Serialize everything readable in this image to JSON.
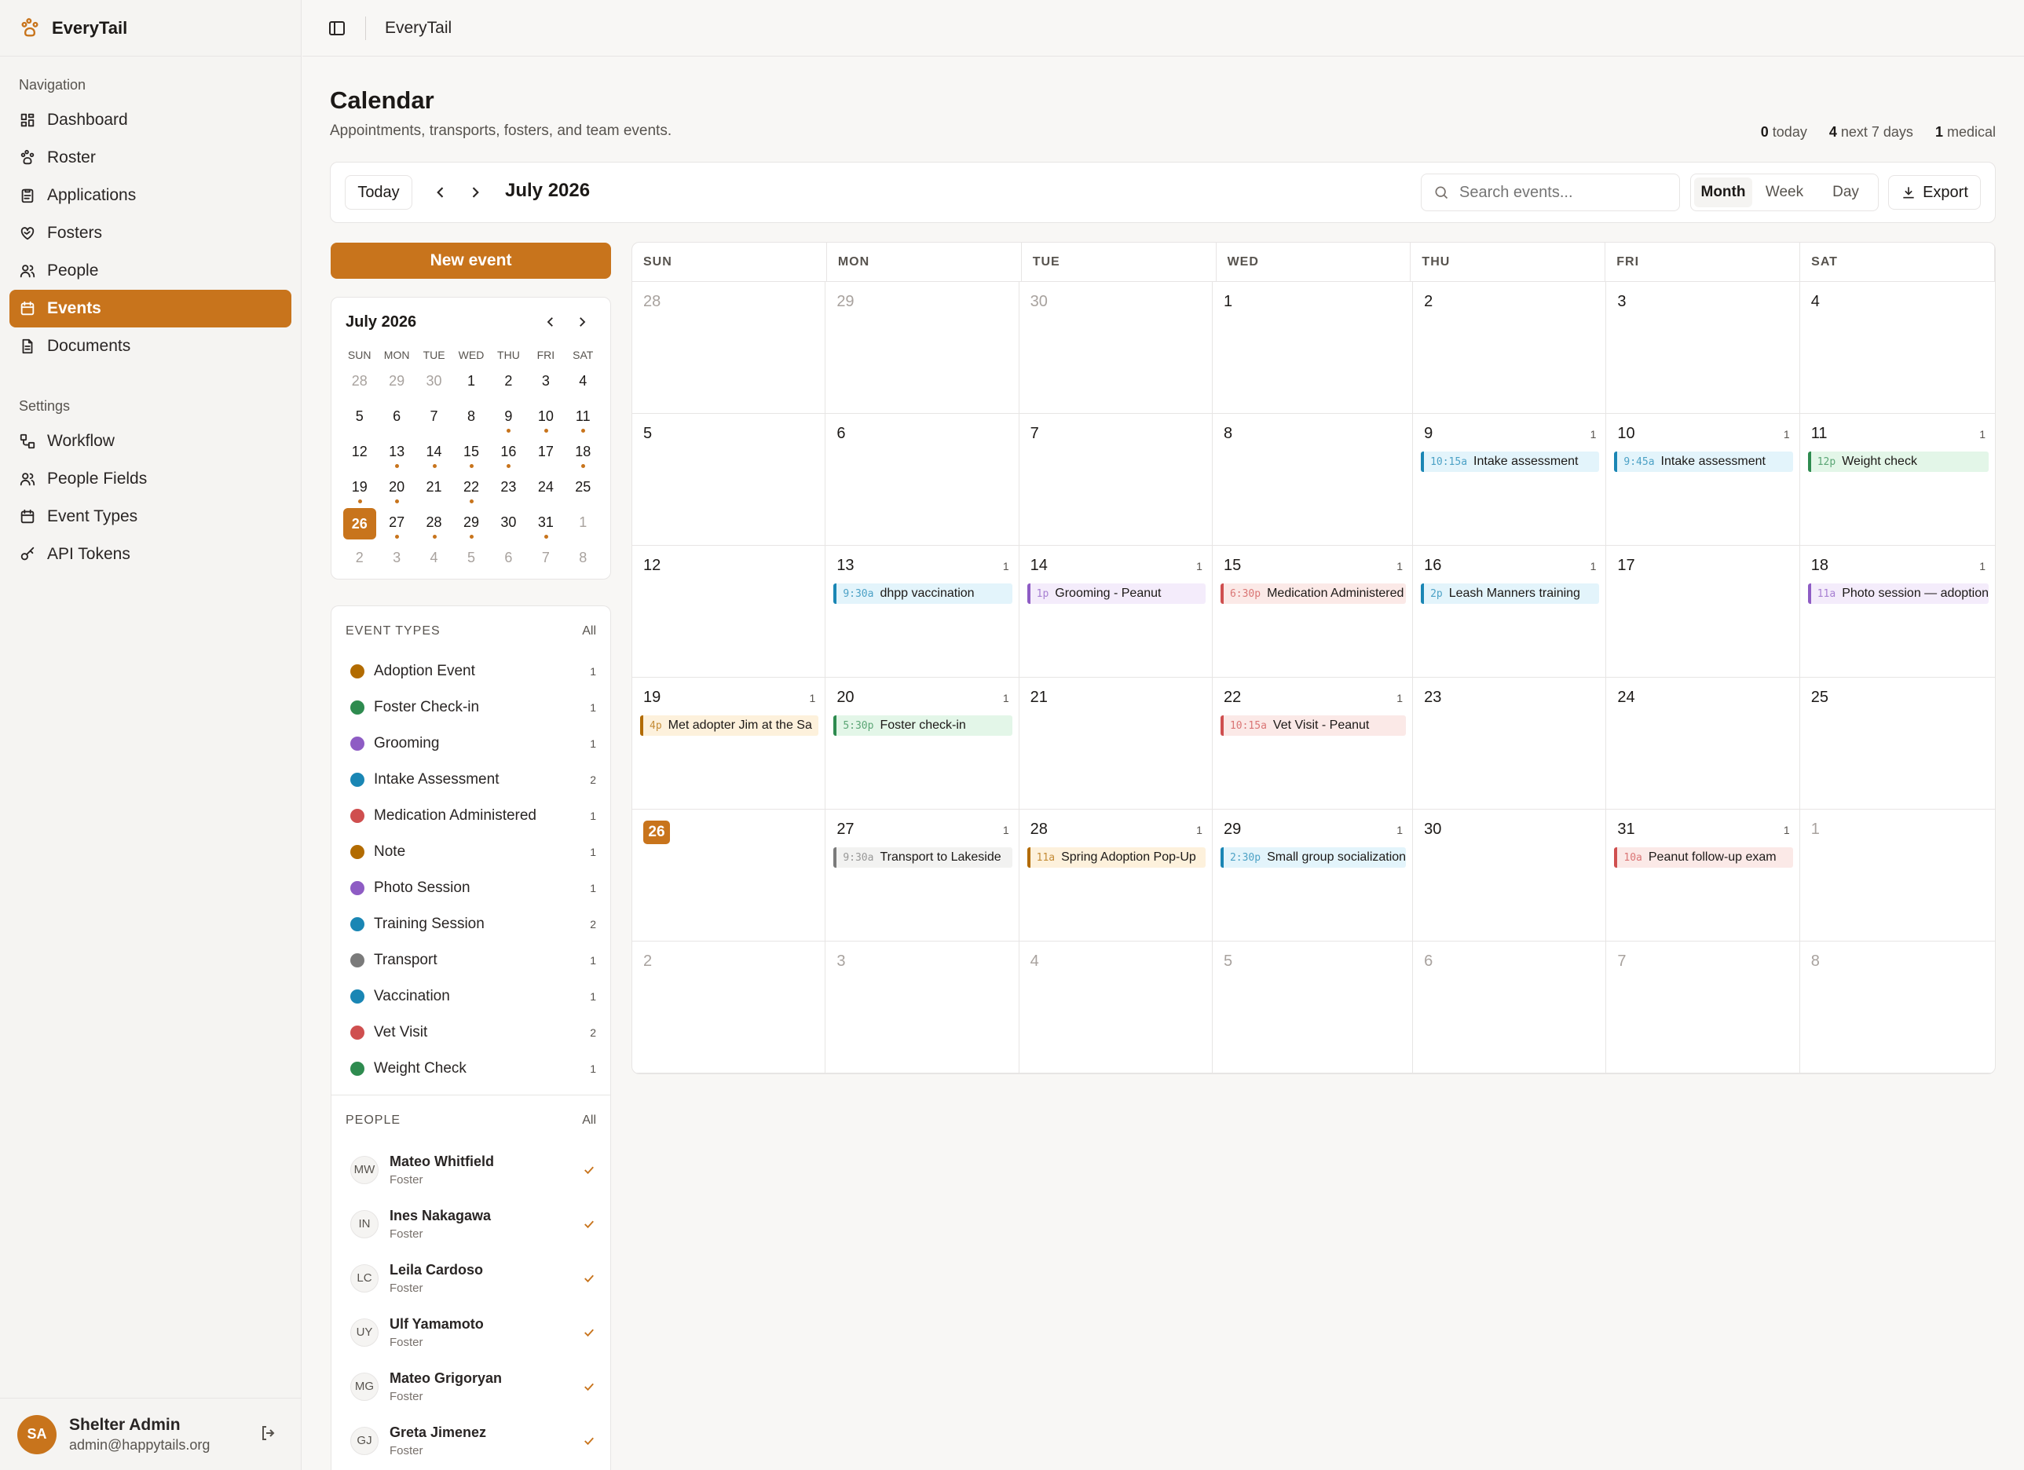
{
  "app": {
    "name": "EveryTail"
  },
  "nav": {
    "label": "Navigation",
    "items": [
      {
        "label": "Dashboard",
        "icon": "dashboard-icon"
      },
      {
        "label": "Roster",
        "icon": "paw-icon"
      },
      {
        "label": "Applications",
        "icon": "clipboard-icon"
      },
      {
        "label": "Fosters",
        "icon": "heart-handshake-icon"
      },
      {
        "label": "People",
        "icon": "people-icon"
      },
      {
        "label": "Events",
        "icon": "calendar-icon",
        "active": true
      },
      {
        "label": "Documents",
        "icon": "document-icon"
      }
    ]
  },
  "settings": {
    "label": "Settings",
    "items": [
      {
        "label": "Workflow",
        "icon": "workflow-icon"
      },
      {
        "label": "People Fields",
        "icon": "people-icon"
      },
      {
        "label": "Event Types",
        "icon": "calendar-icon"
      },
      {
        "label": "API Tokens",
        "icon": "key-icon"
      }
    ]
  },
  "user": {
    "initials": "SA",
    "name": "Shelter Admin",
    "email": "admin@happytails.org"
  },
  "topbar": {
    "title": "EveryTail"
  },
  "page": {
    "title": "Calendar",
    "subtitle": "Appointments, transports, fosters, and team events."
  },
  "stats": {
    "today_num": "0",
    "today_label": "today",
    "week_num": "4",
    "week_label": "next 7 days",
    "medical_num": "1",
    "medical_label": "medical"
  },
  "toolbar": {
    "today": "Today",
    "month": "July 2026",
    "search_placeholder": "Search events...",
    "views": [
      "Month",
      "Week",
      "Day"
    ],
    "active_view": "Month",
    "export": "Export"
  },
  "new_event": "New event",
  "mini": {
    "title": "July 2026",
    "dow": [
      "SUN",
      "MON",
      "TUE",
      "WED",
      "THU",
      "FRI",
      "SAT"
    ],
    "days": [
      {
        "d": "28",
        "out": true
      },
      {
        "d": "29",
        "out": true
      },
      {
        "d": "30",
        "out": true
      },
      {
        "d": "1"
      },
      {
        "d": "2"
      },
      {
        "d": "3"
      },
      {
        "d": "4"
      },
      {
        "d": "5"
      },
      {
        "d": "6"
      },
      {
        "d": "7"
      },
      {
        "d": "8"
      },
      {
        "d": "9",
        "dot": true
      },
      {
        "d": "10",
        "dot": true
      },
      {
        "d": "11",
        "dot": true
      },
      {
        "d": "12"
      },
      {
        "d": "13",
        "dot": true
      },
      {
        "d": "14",
        "dot": true
      },
      {
        "d": "15",
        "dot": true
      },
      {
        "d": "16",
        "dot": true
      },
      {
        "d": "17"
      },
      {
        "d": "18",
        "dot": true
      },
      {
        "d": "19",
        "dot": true
      },
      {
        "d": "20",
        "dot": true
      },
      {
        "d": "21"
      },
      {
        "d": "22",
        "dot": true
      },
      {
        "d": "23"
      },
      {
        "d": "24"
      },
      {
        "d": "25"
      },
      {
        "d": "26",
        "today": true
      },
      {
        "d": "27",
        "dot": true
      },
      {
        "d": "28",
        "dot": true
      },
      {
        "d": "29",
        "dot": true
      },
      {
        "d": "30"
      },
      {
        "d": "31",
        "dot": true
      },
      {
        "d": "1",
        "out": true
      },
      {
        "d": "2",
        "out": true
      },
      {
        "d": "3",
        "out": true
      },
      {
        "d": "4",
        "out": true
      },
      {
        "d": "5",
        "out": true
      },
      {
        "d": "6",
        "out": true
      },
      {
        "d": "7",
        "out": true
      },
      {
        "d": "8",
        "out": true
      }
    ]
  },
  "event_types": {
    "title": "EVENT TYPES",
    "all": "All",
    "items": [
      {
        "name": "Adoption Event",
        "count": "1",
        "color": "#b26b00"
      },
      {
        "name": "Foster Check-in",
        "count": "1",
        "color": "#2e8b4f"
      },
      {
        "name": "Grooming",
        "count": "1",
        "color": "#8e5cc4"
      },
      {
        "name": "Intake Assessment",
        "count": "2",
        "color": "#1a86b4"
      },
      {
        "name": "Medication Administered",
        "count": "1",
        "color": "#cf4f4f"
      },
      {
        "name": "Note",
        "count": "1",
        "color": "#b26b00"
      },
      {
        "name": "Photo Session",
        "count": "1",
        "color": "#8e5cc4"
      },
      {
        "name": "Training Session",
        "count": "2",
        "color": "#1a86b4"
      },
      {
        "name": "Transport",
        "count": "1",
        "color": "#7a7a7a"
      },
      {
        "name": "Vaccination",
        "count": "1",
        "color": "#1a86b4"
      },
      {
        "name": "Vet Visit",
        "count": "2",
        "color": "#cf4f4f"
      },
      {
        "name": "Weight Check",
        "count": "1",
        "color": "#2e8b4f"
      }
    ]
  },
  "people": {
    "title": "PEOPLE",
    "all": "All",
    "items": [
      {
        "initials": "MW",
        "name": "Mateo Whitfield",
        "role": "Foster"
      },
      {
        "initials": "IN",
        "name": "Ines Nakagawa",
        "role": "Foster"
      },
      {
        "initials": "LC",
        "name": "Leila Cardoso",
        "role": "Foster"
      },
      {
        "initials": "UY",
        "name": "Ulf Yamamoto",
        "role": "Foster"
      },
      {
        "initials": "MG",
        "name": "Mateo Grigoryan",
        "role": "Foster"
      },
      {
        "initials": "GJ",
        "name": "Greta Jimenez",
        "role": "Foster"
      }
    ]
  },
  "calendar": {
    "dow": [
      "SUN",
      "MON",
      "TUE",
      "WED",
      "THU",
      "FRI",
      "SAT"
    ],
    "cells": [
      {
        "d": "28",
        "out": true
      },
      {
        "d": "29",
        "out": true
      },
      {
        "d": "30",
        "out": true
      },
      {
        "d": "1"
      },
      {
        "d": "2"
      },
      {
        "d": "3"
      },
      {
        "d": "4"
      },
      {
        "d": "5"
      },
      {
        "d": "6"
      },
      {
        "d": "7"
      },
      {
        "d": "8"
      },
      {
        "d": "9",
        "count": "1",
        "events": [
          {
            "time": "10:15a",
            "title": "Intake assessment",
            "color": "#1a86b4",
            "bg": "#e3f4fb"
          }
        ]
      },
      {
        "d": "10",
        "count": "1",
        "events": [
          {
            "time": "9:45a",
            "title": "Intake assessment",
            "color": "#1a86b4",
            "bg": "#e3f4fb"
          }
        ]
      },
      {
        "d": "11",
        "count": "1",
        "events": [
          {
            "time": "12p",
            "title": "Weight check",
            "color": "#2e8b4f",
            "bg": "#e3f6e8"
          }
        ]
      },
      {
        "d": "12"
      },
      {
        "d": "13",
        "count": "1",
        "events": [
          {
            "time": "9:30a",
            "title": "dhpp vaccination",
            "color": "#1a86b4",
            "bg": "#e3f4fb"
          }
        ]
      },
      {
        "d": "14",
        "count": "1",
        "events": [
          {
            "time": "1p",
            "title": "Grooming - Peanut",
            "color": "#8e5cc4",
            "bg": "#f4ecfb"
          }
        ]
      },
      {
        "d": "15",
        "count": "1",
        "events": [
          {
            "time": "6:30p",
            "title": "Medication Administered",
            "color": "#cf4f4f",
            "bg": "#fbe9e7"
          }
        ]
      },
      {
        "d": "16",
        "count": "1",
        "events": [
          {
            "time": "2p",
            "title": "Leash Manners training",
            "color": "#1a86b4",
            "bg": "#e3f4fb"
          }
        ]
      },
      {
        "d": "17"
      },
      {
        "d": "18",
        "count": "1",
        "events": [
          {
            "time": "11a",
            "title": "Photo session — adoption",
            "color": "#8e5cc4",
            "bg": "#f4ecfb"
          }
        ]
      },
      {
        "d": "19",
        "count": "1",
        "events": [
          {
            "time": "4p",
            "title": "Met adopter Jim at the Sa",
            "color": "#b26b00",
            "bg": "#fdf1dc"
          }
        ]
      },
      {
        "d": "20",
        "count": "1",
        "events": [
          {
            "time": "5:30p",
            "title": "Foster check-in",
            "color": "#2e8b4f",
            "bg": "#e3f6e8"
          }
        ]
      },
      {
        "d": "21"
      },
      {
        "d": "22",
        "count": "1",
        "events": [
          {
            "time": "10:15a",
            "title": "Vet Visit - Peanut",
            "color": "#cf4f4f",
            "bg": "#fbe9e7"
          }
        ]
      },
      {
        "d": "23"
      },
      {
        "d": "24"
      },
      {
        "d": "25"
      },
      {
        "d": "26",
        "today": true
      },
      {
        "d": "27",
        "count": "1",
        "events": [
          {
            "time": "9:30a",
            "title": "Transport to Lakeside",
            "color": "#7a7a7a",
            "bg": "#f2f2f1"
          }
        ]
      },
      {
        "d": "28",
        "count": "1",
        "events": [
          {
            "time": "11a",
            "title": "Spring Adoption Pop-Up",
            "color": "#b26b00",
            "bg": "#fdf1dc"
          }
        ]
      },
      {
        "d": "29",
        "count": "1",
        "events": [
          {
            "time": "2:30p",
            "title": "Small group socialization",
            "color": "#1a86b4",
            "bg": "#e3f4fb"
          }
        ]
      },
      {
        "d": "30"
      },
      {
        "d": "31",
        "count": "1",
        "events": [
          {
            "time": "10a",
            "title": "Peanut follow-up exam",
            "color": "#cf4f4f",
            "bg": "#fbe9e7"
          }
        ]
      },
      {
        "d": "1",
        "out": true
      },
      {
        "d": "2",
        "out": true
      },
      {
        "d": "3",
        "out": true
      },
      {
        "d": "4",
        "out": true
      },
      {
        "d": "5",
        "out": true
      },
      {
        "d": "6",
        "out": true
      },
      {
        "d": "7",
        "out": true
      },
      {
        "d": "8",
        "out": true
      }
    ]
  }
}
